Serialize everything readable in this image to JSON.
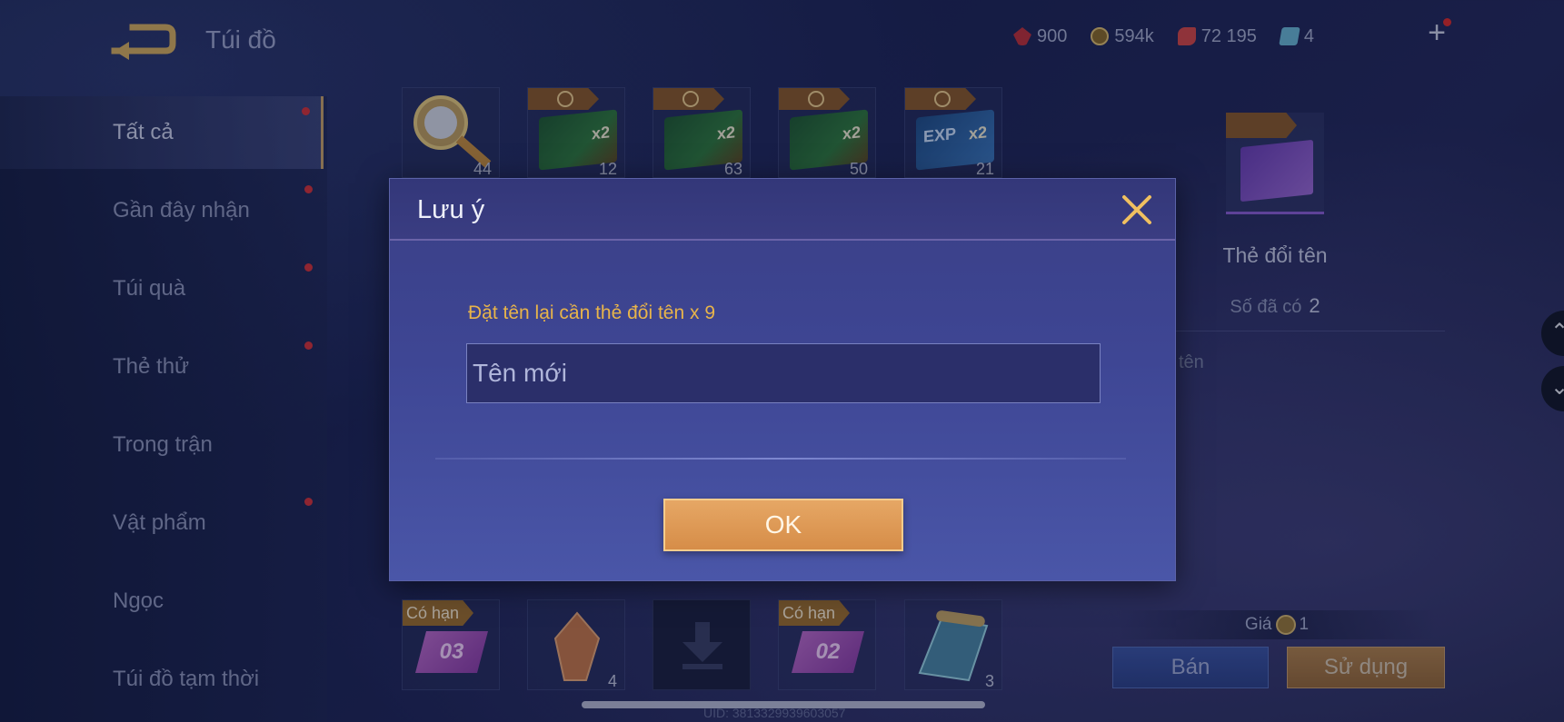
{
  "header": {
    "title": "Túi đồ",
    "currencies": [
      {
        "icon": "red-gem-icon",
        "value": "900",
        "color": "#c0303a"
      },
      {
        "icon": "gold-coin-icon",
        "value": "594k",
        "color": "#d8b048"
      },
      {
        "icon": "ruby-icon",
        "value": "72 195",
        "color": "#d84848"
      },
      {
        "icon": "crystal-card-icon",
        "value": "4",
        "color": "#6ab8d8"
      }
    ]
  },
  "sidebar": {
    "items": [
      {
        "label": "Tất cả",
        "active": true,
        "dot": true
      },
      {
        "label": "Gần đây nhận",
        "dot": true
      },
      {
        "label": "Túi quà",
        "dot": true
      },
      {
        "label": "Thẻ thử",
        "dot": true
      },
      {
        "label": "Trong trận",
        "dot": false
      },
      {
        "label": "Vật phẩm",
        "dot": true
      },
      {
        "label": "Ngọc",
        "dot": false
      },
      {
        "label": "Túi đồ tạm thời",
        "dot": false
      }
    ]
  },
  "grid": {
    "top_row": [
      {
        "icon": "compass-scepter-icon",
        "count": "44"
      },
      {
        "icon": "gold-x2-card-icon",
        "label": "x2",
        "count": "12"
      },
      {
        "icon": "gold-x2-card-icon",
        "label": "x2",
        "count": "63"
      },
      {
        "icon": "gold-x2-card-icon",
        "label": "x2",
        "count": "50"
      },
      {
        "icon": "exp-x2-card-icon",
        "label": "EXP",
        "label2": "x2",
        "count": "21"
      }
    ],
    "bottom_row": [
      {
        "icon": "purple-ticket-icon",
        "tag": "Có hạn",
        "label": "03"
      },
      {
        "icon": "crystal-shard-icon",
        "count": "4"
      },
      {
        "icon": "download-icon"
      },
      {
        "icon": "purple-ticket-icon",
        "tag": "Có hạn",
        "label": "02"
      },
      {
        "icon": "map-scroll-icon",
        "count": "3"
      }
    ]
  },
  "detail": {
    "name": "Thẻ đổi tên",
    "owned_label": "Số đã có",
    "owned_value": "2",
    "description_fragment": "tên",
    "price_label": "Giá",
    "price_value": "1",
    "sell_label": "Bán",
    "use_label": "Sử dụng"
  },
  "footer": {
    "uid": "UID: 3813329939603057"
  },
  "dialog": {
    "title": "Lưu ý",
    "prompt": "Đặt tên lại cần thẻ đổi tên x 9",
    "input_placeholder": "Tên mới",
    "input_value": "",
    "ok_label": "OK"
  },
  "colors": {
    "accent_gold": "#e8b44a",
    "dialog_bg": "#3e4694",
    "ok_button": "#d68d48",
    "notification_dot": "#d8323a"
  }
}
